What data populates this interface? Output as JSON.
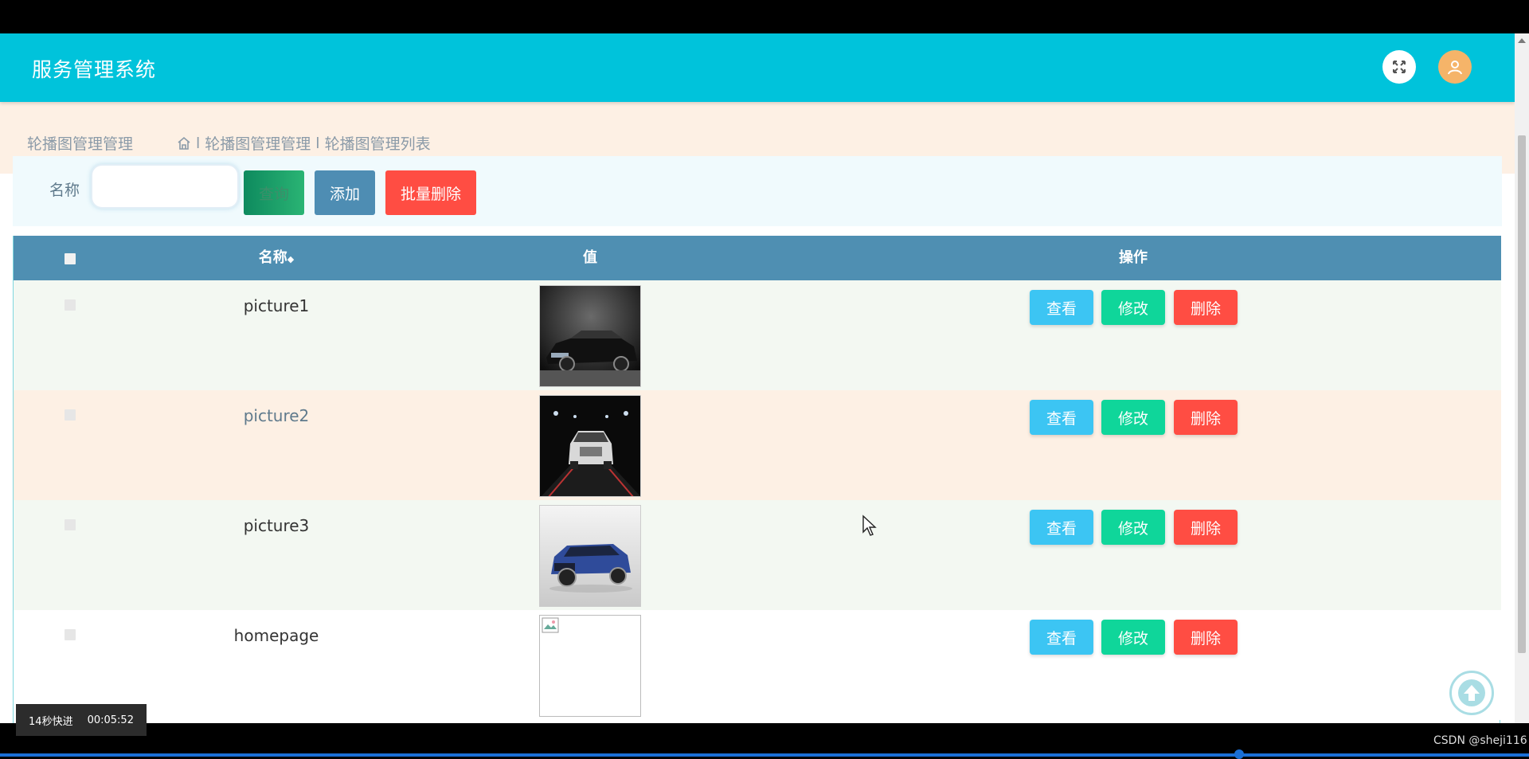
{
  "header": {
    "title": "服务管理系统"
  },
  "breadcrumb": {
    "title": "轮播图管理管理",
    "sep1": "l",
    "crumb1": "轮播图管理管理",
    "sep2": "l",
    "crumb2": "轮播图管理列表"
  },
  "search": {
    "label": "名称",
    "value": "",
    "placeholder": "",
    "query_label": "查询",
    "add_label": "添加",
    "batch_delete_label": "批量删除"
  },
  "table": {
    "columns": {
      "name": "名称",
      "sort_mark": "◆",
      "value": "值",
      "actions": "操作"
    },
    "actions": {
      "view": "查看",
      "edit": "修改",
      "delete": "删除"
    },
    "rows": [
      {
        "name": "picture1",
        "image": "car-black-sedan"
      },
      {
        "name": "picture2",
        "image": "car-white-front"
      },
      {
        "name": "picture3",
        "image": "car-blue-suv"
      },
      {
        "name": "homepage",
        "image": "broken-image"
      }
    ]
  },
  "overlay": {
    "video_speed": "14秒快进",
    "video_time": "00:05:52",
    "watermark": "CSDN @sheji116"
  },
  "colors": {
    "header": "#00c3db",
    "table_header": "#4f8fb2",
    "view": "#3cc5f3",
    "edit": "#0fd69a",
    "delete": "#ff4d43",
    "add": "#4e8db3"
  }
}
